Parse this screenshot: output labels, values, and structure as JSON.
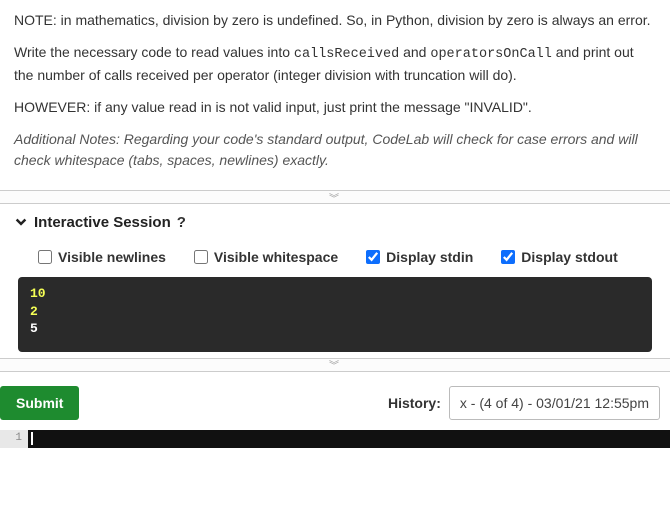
{
  "instructions": {
    "p1_prefix": "NOTE: in mathematics, division by zero is undefined. So, in Python, division by zero is always an error.",
    "p2_before_code1": "Write the necessary code to read values into ",
    "code1": "callsReceived",
    "p2_mid": " and ",
    "code2": "operatorsOnCall",
    "p2_after_code2": " and print out the number of calls received per operator (integer division with truncation will do).",
    "p3": "HOWEVER: if any value read in is not valid input, just print the message \"INVALID\".",
    "notes": "Additional Notes: Regarding your code's standard output, CodeLab will check for case errors and will check whitespace (tabs, spaces, newlines) exactly."
  },
  "section": {
    "title": "Interactive Session",
    "help": "?"
  },
  "checks": {
    "visible_newlines": "Visible newlines",
    "visible_whitespace": "Visible whitespace",
    "display_stdin": "Display stdin",
    "display_stdout": "Display stdout"
  },
  "terminal": {
    "lines": [
      {
        "type": "stdin",
        "text": "10"
      },
      {
        "type": "stdin",
        "text": "2"
      },
      {
        "type": "stdout",
        "text": "5"
      }
    ]
  },
  "submit": {
    "label": "Submit"
  },
  "history": {
    "label": "History:",
    "selected": "x - (4 of 4) - 03/01/21 12:55pm"
  },
  "editor": {
    "line_number": "1"
  }
}
